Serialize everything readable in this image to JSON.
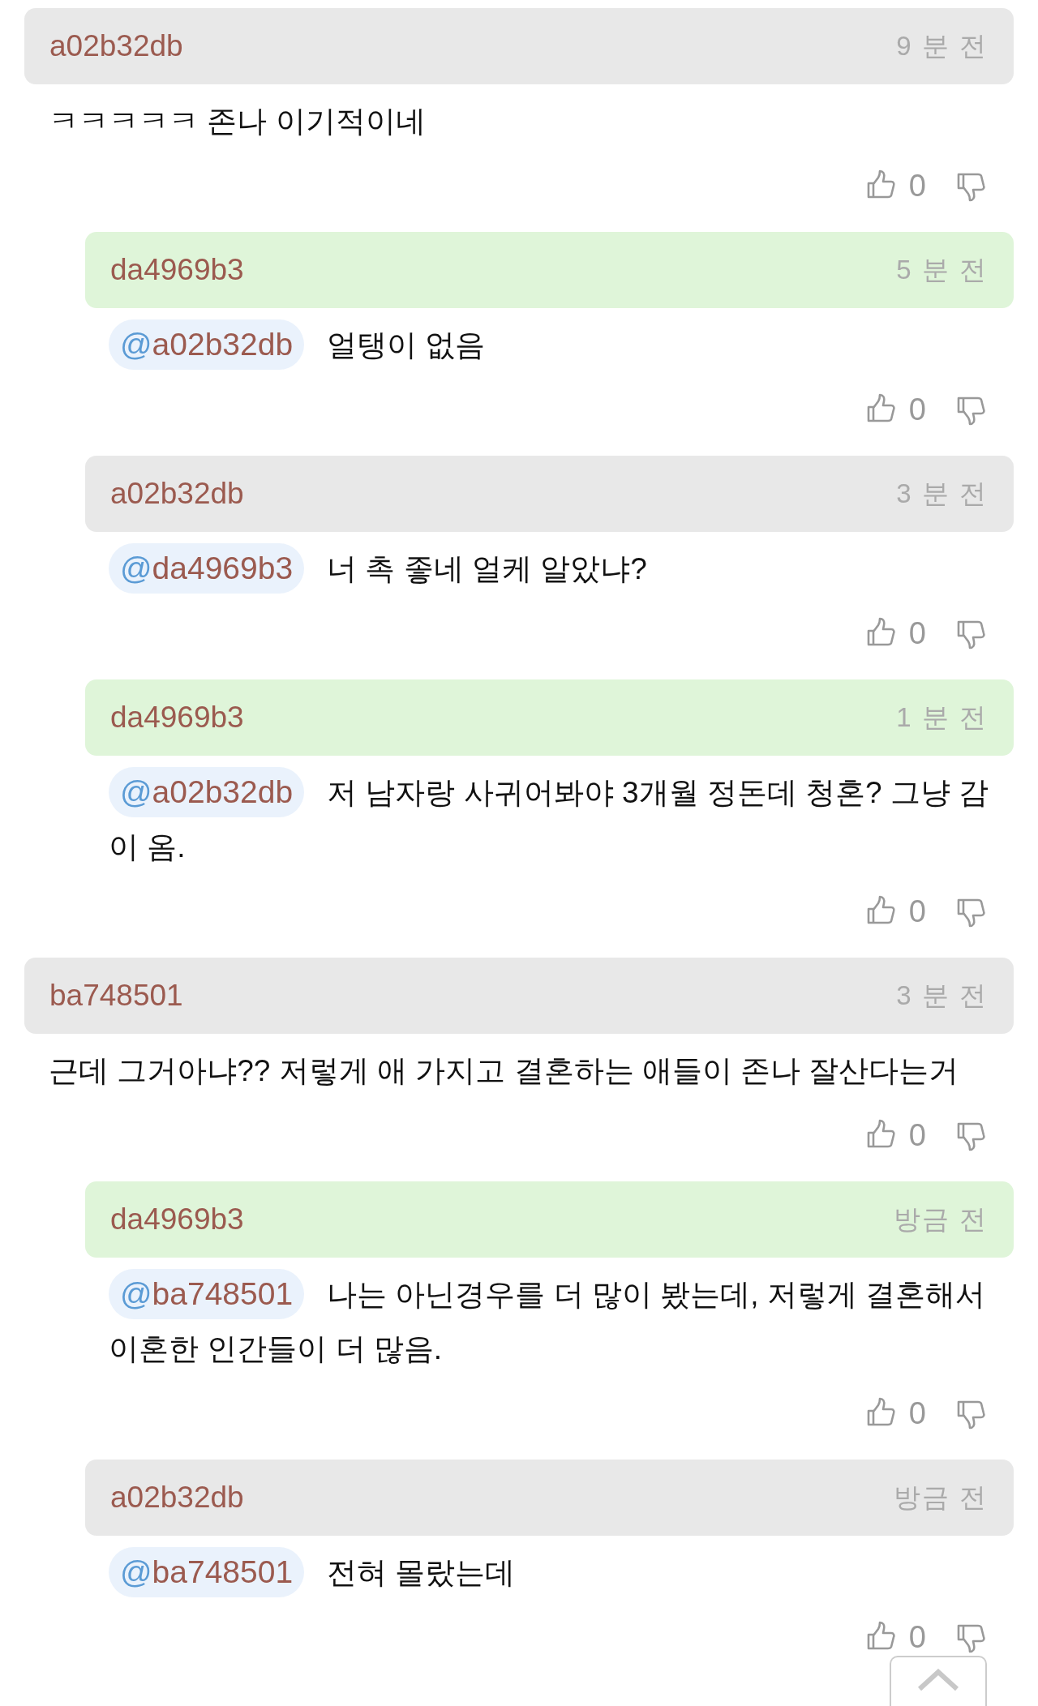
{
  "comments": [
    {
      "author": "a02b32db",
      "time": "9 분 전",
      "color": "#e8e8e8",
      "text": "ㅋㅋㅋㅋㅋ 존나 이기적이네",
      "likes": "0",
      "children": [
        {
          "author": "da4969b3",
          "time": "5 분 전",
          "color": "#dff5d9",
          "mention": {
            "at": "@",
            "name": "a02b32db"
          },
          "text": "얼탱이 없음",
          "likes": "0"
        },
        {
          "author": "a02b32db",
          "time": "3 분 전",
          "color": "#e8e8e8",
          "mention": {
            "at": "@",
            "name": "da4969b3"
          },
          "text": "너 촉 좋네 얼케 알았냐?",
          "likes": "0"
        },
        {
          "author": "da4969b3",
          "time": "1 분 전",
          "color": "#dff5d9",
          "mention": {
            "at": "@",
            "name": "a02b32db"
          },
          "text": "저 남자랑 사귀어봐야 3개월 정돈데 청혼? 그냥 감이 옴.",
          "likes": "0"
        }
      ]
    },
    {
      "author": "ba748501",
      "time": "3 분 전",
      "color": "#e8e8e8",
      "text": "근데 그거아냐?? 저렇게 애 가지고 결혼하는 애들이 존나 잘산다는거",
      "likes": "0",
      "children": [
        {
          "author": "da4969b3",
          "time": "방금 전",
          "color": "#dff5d9",
          "mention": {
            "at": "@",
            "name": "ba748501"
          },
          "text": "나는 아닌경우를 더 많이 봤는데, 저렇게 결혼해서 이혼한 인간들이 더 많음.",
          "likes": "0"
        },
        {
          "author": "a02b32db",
          "time": "방금 전",
          "color": "#e8e8e8",
          "mention": {
            "at": "@",
            "name": "ba748501"
          },
          "text": "전혀 몰랐는데",
          "likes": "0"
        }
      ]
    }
  ]
}
